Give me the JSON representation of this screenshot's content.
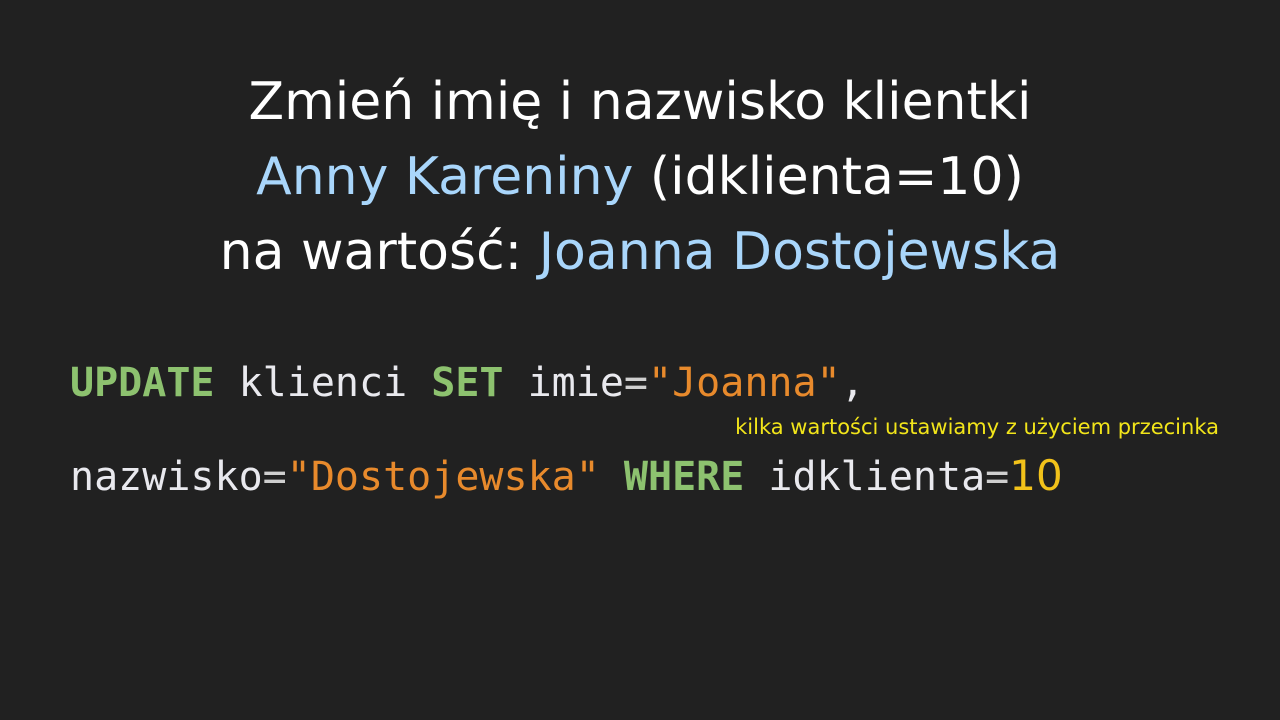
{
  "title": {
    "line1": "Zmień imię i nazwisko klientki",
    "line2_name": "Anny Kareniny",
    "line2_rest": " (idklienta=10)",
    "line3_prefix": "na wartość: ",
    "line3_value": "Joanna Dostojewska"
  },
  "code": {
    "line1": {
      "kw_update": "UPDATE",
      "table": " klienci ",
      "kw_set": "SET",
      "col_imie": " imie",
      "eq1": "=",
      "val_imie": "\"Joanna\"",
      "comma": ","
    },
    "line2": {
      "col_nazwisko": "nazwisko",
      "eq2": "=",
      "val_nazwisko": "\"Dostojewska\"",
      "kw_where": " WHERE",
      "col_id": " idklienta",
      "eq3": "=",
      "val_id": "10"
    }
  },
  "note": "kilka wartości ustawiamy z użyciem przecinka",
  "colors": {
    "background": "#212121",
    "highlight": "#a9d6fb",
    "keyword": "#8dc26f",
    "string": "#e88a2c",
    "number": "#f2c21a",
    "note": "#f2e51a"
  }
}
